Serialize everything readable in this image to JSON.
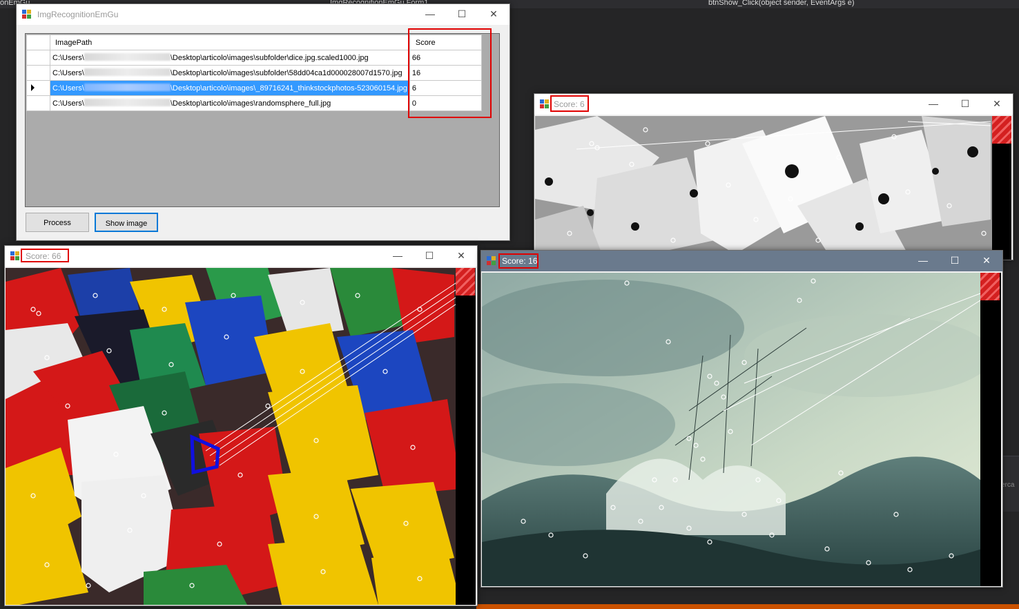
{
  "ide": {
    "tab_left": "onEmGu",
    "tab_form": "ImgRecognitionEmGu.Form1",
    "method_signature": "btnShow_Click(object sender, EventArgs e)",
    "side_label": "erca"
  },
  "main_window": {
    "title": "ImgRecognitionEmGu",
    "grid": {
      "headers": [
        "ImagePath",
        "Score"
      ],
      "rows": [
        {
          "path_prefix": "C:\\Users\\",
          "path_suffix": "\\Desktop\\articolo\\images\\subfolder\\dice.jpg.scaled1000.jpg",
          "score": "66",
          "selected": false
        },
        {
          "path_prefix": "C:\\Users\\",
          "path_suffix": "\\Desktop\\articolo\\images\\subfolder\\58dd04ca1d000028007d1570.jpg",
          "score": "16",
          "selected": false
        },
        {
          "path_prefix": "C:\\Users\\",
          "path_suffix": "\\Desktop\\articolo\\images\\_89716241_thinkstockphotos-523060154.jpg",
          "score": "6",
          "selected": true
        },
        {
          "path_prefix": "C:\\Users\\",
          "path_suffix": "\\Desktop\\articolo\\images\\randomsphere_full.jpg",
          "score": "0",
          "selected": false
        }
      ]
    },
    "buttons": {
      "process": "Process",
      "show_image": "Show image"
    }
  },
  "score_windows": [
    {
      "title": "Score: 6",
      "image": "white dice matches"
    },
    {
      "title": "Score: 66",
      "image": "colored dice matches"
    },
    {
      "title": "Score: 16",
      "image": "stormy sea ship matches"
    }
  ],
  "window_controls": {
    "minimize": "—",
    "maximize": "☐",
    "close": "✕"
  },
  "colors": {
    "highlight": "#3399ff",
    "accent_red": "#e00000",
    "match_box": "#1010e0"
  }
}
